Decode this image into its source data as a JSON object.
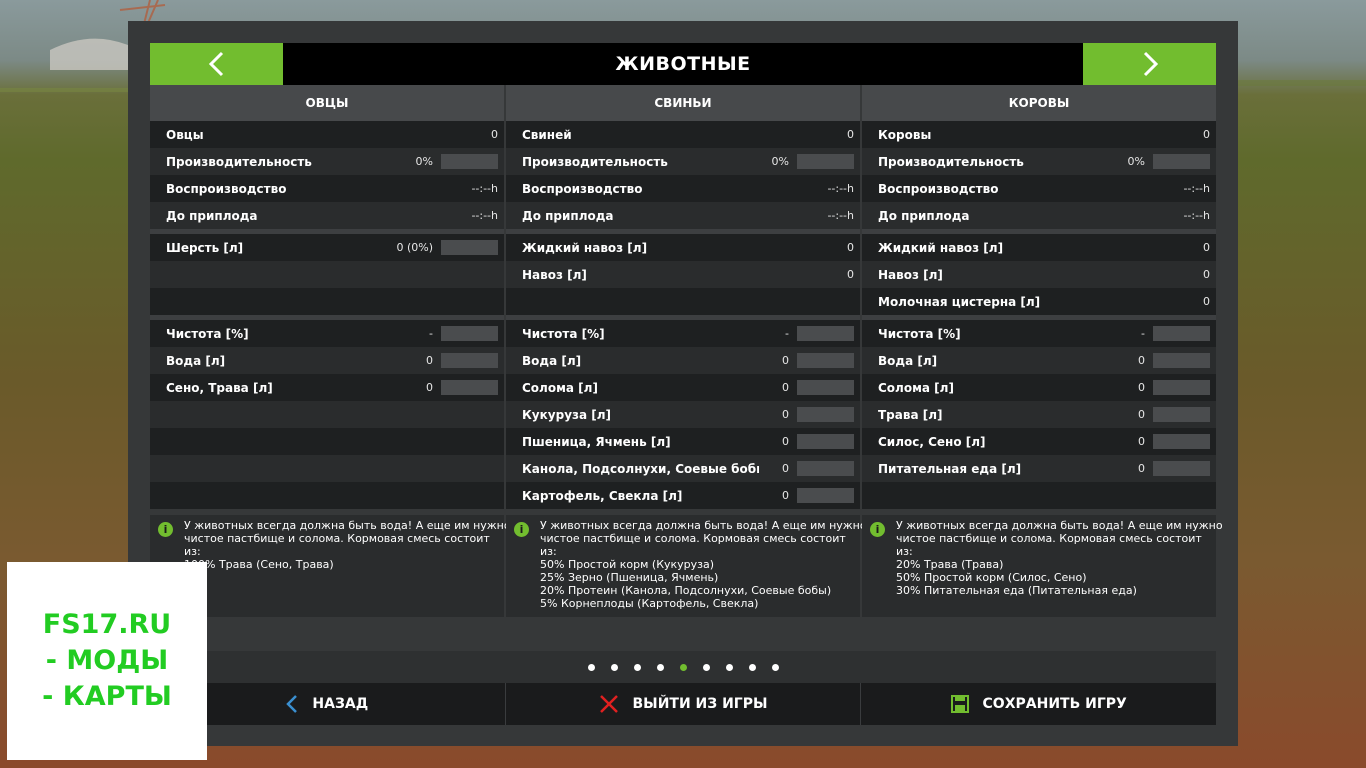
{
  "title": "ЖИВОТНЫЕ",
  "columns": [
    {
      "header": "ОВЦЫ",
      "groups": [
        [
          {
            "label": "Овцы",
            "value": "0",
            "bar": false
          },
          {
            "label": "Производительность",
            "value": "0%",
            "bar": true
          },
          {
            "label": "Воспроизводство",
            "value": "--:--h",
            "bar": false
          },
          {
            "label": "До приплода",
            "value": "--:--h",
            "bar": false
          }
        ],
        [
          {
            "label": "Шерсть [л]",
            "value": "0 (0%)",
            "bar": true
          },
          {
            "label": "",
            "value": "",
            "bar": false
          },
          {
            "label": "",
            "value": "",
            "bar": false
          }
        ],
        [
          {
            "label": "Чистота [%]",
            "value": "-",
            "bar": true
          },
          {
            "label": "Вода [л]",
            "value": "0",
            "bar": true
          },
          {
            "label": "Сено, Трава [л]",
            "value": "0",
            "bar": true
          },
          {
            "label": "",
            "value": "",
            "bar": false
          },
          {
            "label": "",
            "value": "",
            "bar": false
          },
          {
            "label": "",
            "value": "",
            "bar": false
          },
          {
            "label": "",
            "value": "",
            "bar": false
          }
        ]
      ],
      "info": [
        "У животных всегда должна быть вода! А еще им нужно",
        "чистое пастбище и солома. Кормовая смесь состоит",
        "из:",
        "100% Трава (Сено, Трава)"
      ]
    },
    {
      "header": "СВИНЬИ",
      "groups": [
        [
          {
            "label": "Свиней",
            "value": "0",
            "bar": false
          },
          {
            "label": "Производительность",
            "value": "0%",
            "bar": true
          },
          {
            "label": "Воспроизводство",
            "value": "--:--h",
            "bar": false
          },
          {
            "label": "До приплода",
            "value": "--:--h",
            "bar": false
          }
        ],
        [
          {
            "label": "Жидкий навоз [л]",
            "value": "0",
            "bar": false
          },
          {
            "label": "Навоз [л]",
            "value": "0",
            "bar": false
          },
          {
            "label": "",
            "value": "",
            "bar": false
          }
        ],
        [
          {
            "label": "Чистота [%]",
            "value": "-",
            "bar": true
          },
          {
            "label": "Вода [л]",
            "value": "0",
            "bar": true
          },
          {
            "label": "Солома [л]",
            "value": "0",
            "bar": true
          },
          {
            "label": "Кукуруза [л]",
            "value": "0",
            "bar": true
          },
          {
            "label": "Пшеница, Ячмень [л]",
            "value": "0",
            "bar": true
          },
          {
            "label": "Канола, Подсолнухи, Соевые бобы [л]",
            "value": "0",
            "bar": true
          },
          {
            "label": "Картофель, Свекла [л]",
            "value": "0",
            "bar": true
          }
        ]
      ],
      "info": [
        "У животных всегда должна быть вода! А еще им нужно",
        "чистое пастбище и солома. Кормовая смесь состоит",
        "из:",
        "50% Простой корм (Кукуруза)",
        "25% Зерно (Пшеница, Ячмень)",
        "20% Протеин (Канола, Подсолнухи, Соевые бобы)",
        "5% Корнеплоды (Картофель, Свекла)"
      ]
    },
    {
      "header": "КОРОВЫ",
      "groups": [
        [
          {
            "label": "Коровы",
            "value": "0",
            "bar": false
          },
          {
            "label": "Производительность",
            "value": "0%",
            "bar": true
          },
          {
            "label": "Воспроизводство",
            "value": "--:--h",
            "bar": false
          },
          {
            "label": "До приплода",
            "value": "--:--h",
            "bar": false
          }
        ],
        [
          {
            "label": "Жидкий навоз [л]",
            "value": "0",
            "bar": false
          },
          {
            "label": "Навоз [л]",
            "value": "0",
            "bar": false
          },
          {
            "label": "Молочная цистерна [л]",
            "value": "0",
            "bar": false
          }
        ],
        [
          {
            "label": "Чистота [%]",
            "value": "-",
            "bar": true
          },
          {
            "label": "Вода [л]",
            "value": "0",
            "bar": true
          },
          {
            "label": "Солома [л]",
            "value": "0",
            "bar": true
          },
          {
            "label": "Трава [л]",
            "value": "0",
            "bar": true
          },
          {
            "label": "Силос, Сено [л]",
            "value": "0",
            "bar": true
          },
          {
            "label": "Питательная еда [л]",
            "value": "0",
            "bar": true
          },
          {
            "label": "",
            "value": "",
            "bar": false
          }
        ]
      ],
      "info": [
        "У животных всегда должна быть вода! А еще им нужно",
        "чистое пастбище и солома. Кормовая смесь состоит",
        "из:",
        "20% Трава (Трава)",
        "50% Простой корм (Силос, Сено)",
        "30% Питательная еда (Питательная еда)"
      ]
    }
  ],
  "pager": {
    "count": 9,
    "active_index": 4
  },
  "bottom": {
    "back": "НАЗАД",
    "quit": "ВЫЙТИ ИЗ ИГРЫ",
    "save": "СОХРАНИТЬ ИГРУ"
  },
  "watermark": {
    "line1": "FS17.RU",
    "line2": "- МОДЫ",
    "line3": "- КАРТЫ"
  },
  "colors": {
    "accent": "#72bd2f",
    "panel": "#363839",
    "row_dark": "#1e2021",
    "row_light": "#2a2c2d",
    "quit_x": "#e02020",
    "back_arrow": "#3a8fd0"
  }
}
